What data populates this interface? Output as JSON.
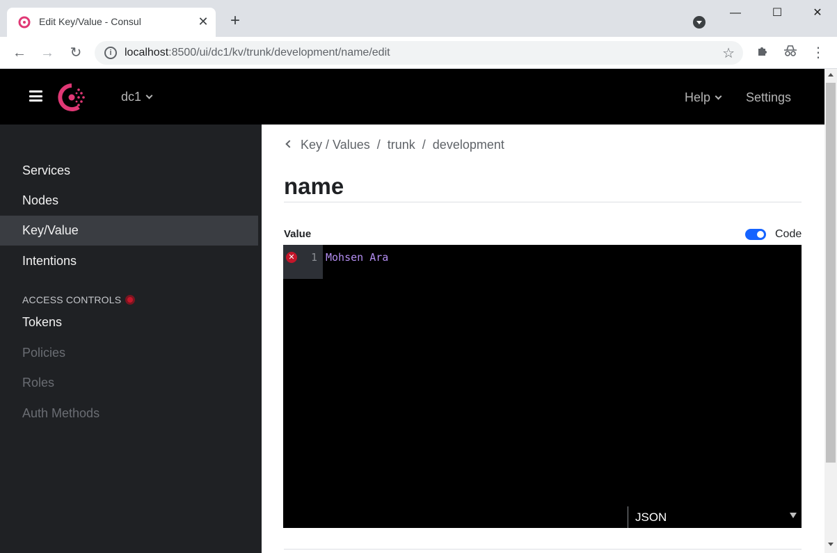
{
  "browser": {
    "tab_title": "Edit Key/Value - Consul",
    "url_host": "localhost",
    "url_rest": ":8500/ui/dc1/kv/trunk/development/name/edit"
  },
  "header": {
    "datacenter": "dc1",
    "help_label": "Help",
    "settings_label": "Settings"
  },
  "sidebar": {
    "items": [
      {
        "label": "Services"
      },
      {
        "label": "Nodes"
      },
      {
        "label": "Key/Value"
      },
      {
        "label": "Intentions"
      }
    ],
    "access_heading": "ACCESS CONTROLS",
    "access_items": [
      {
        "label": "Tokens"
      },
      {
        "label": "Policies"
      },
      {
        "label": "Roles"
      },
      {
        "label": "Auth Methods"
      }
    ]
  },
  "main": {
    "breadcrumbs": [
      "Key / Values",
      "trunk",
      "development"
    ],
    "crumb_sep": "/",
    "title": "name",
    "value_label": "Value",
    "code_label": "Code",
    "editor": {
      "line_number": "1",
      "content": "Mohsen Ara",
      "mode": "JSON"
    }
  },
  "colors": {
    "brand": "#e03875",
    "toggle": "#1563ff",
    "error": "#c4162a"
  }
}
